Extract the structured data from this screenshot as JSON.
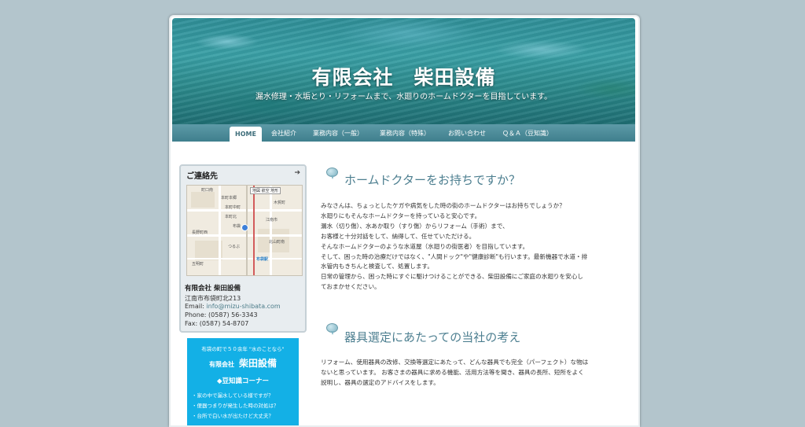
{
  "header": {
    "title": "有限会社　柴田設備",
    "subtitle": "漏水修理・水垢とり・リフォームまで、水廻りのホームドクターを目指しています。"
  },
  "nav": {
    "items": [
      {
        "label": "HOME"
      },
      {
        "label": "会社紹介"
      },
      {
        "label": "業務内容（一般）"
      },
      {
        "label": "業務内容（特殊）"
      },
      {
        "label": "お問い合わせ"
      },
      {
        "label": "Ｑ＆Ａ（豆知識）"
      }
    ]
  },
  "sidebar": {
    "contact_title": "ご連絡先",
    "map": {
      "zoom_label": "地図 航空 地形",
      "labels": [
        "町口南",
        "本町本郷",
        "本町中町",
        "本町北",
        "布袋",
        "つるぶ",
        "北山町南",
        "布袋駅",
        "長野町西",
        "江南市",
        "五明町",
        "木賀町"
      ]
    },
    "company": "有限会社 柴田設備",
    "address": "江南市布袋町北213",
    "email_label": "Email:",
    "email": "info@mizu-shibata.com",
    "phone": "Phone: (0587) 56-3343",
    "fax": "Fax: (0587) 54-8707"
  },
  "banner": {
    "top_text": "布袋の町で５０余年 \"水のことなら\"",
    "company_small": "有限会社",
    "company_big": "柴田設備",
    "corner_title": "◆豆知識コーナー",
    "items": [
      "・家の中で漏水している様ですが？",
      "・便器つまりが発生した時の対処は？",
      "・台所で白い水が出たけど大丈夫？"
    ]
  },
  "main": {
    "sections": [
      {
        "heading": "ホームドクターをお持ちですか？",
        "lines": [
          "みなさんは、ちょっとしたケガや病気をした時の街のホームドクターはお持ちでしょうか？",
          "水廻りにもそんなホームドクターを持っていると安心です。",
          "漏水（切り傷）、水あか取り（すり傷）からリフォーム（手術）まで、",
          "お客様と十分対話をして、納得して、任せていただける。",
          "そんなホームドクターのような水道屋（水廻りの街医者）を目指しています。",
          "そして、困った時の治療だけではなく、\"人間ドック\"や\"健康診断\"も行います。最新機器で水道・排",
          "水管内もきちんと検査して、処置します。",
          "日常の管理から、困った時にすぐに駆けつけることができる、柴田設備にご家庭の水廻りを安心し",
          "ておまかせください。"
        ]
      },
      {
        "heading": "器具選定にあたっての当社の考え",
        "lines": [
          "リフォーム、使用器具の改修、交換等選定にあたって、どんな器具でも完全（パーフェクト）な物は",
          "ないと思っています。 お客さまの器具に求める機能、活用方法等を聞き、器具の長所、短所をよく",
          "説明し、器具の選定のアドバイスをします。"
        ]
      }
    ]
  },
  "colors": {
    "background": "#b3c5cc",
    "nav": "#4a8a98",
    "heading": "#4d7f90",
    "banner": "#13b0e6"
  }
}
